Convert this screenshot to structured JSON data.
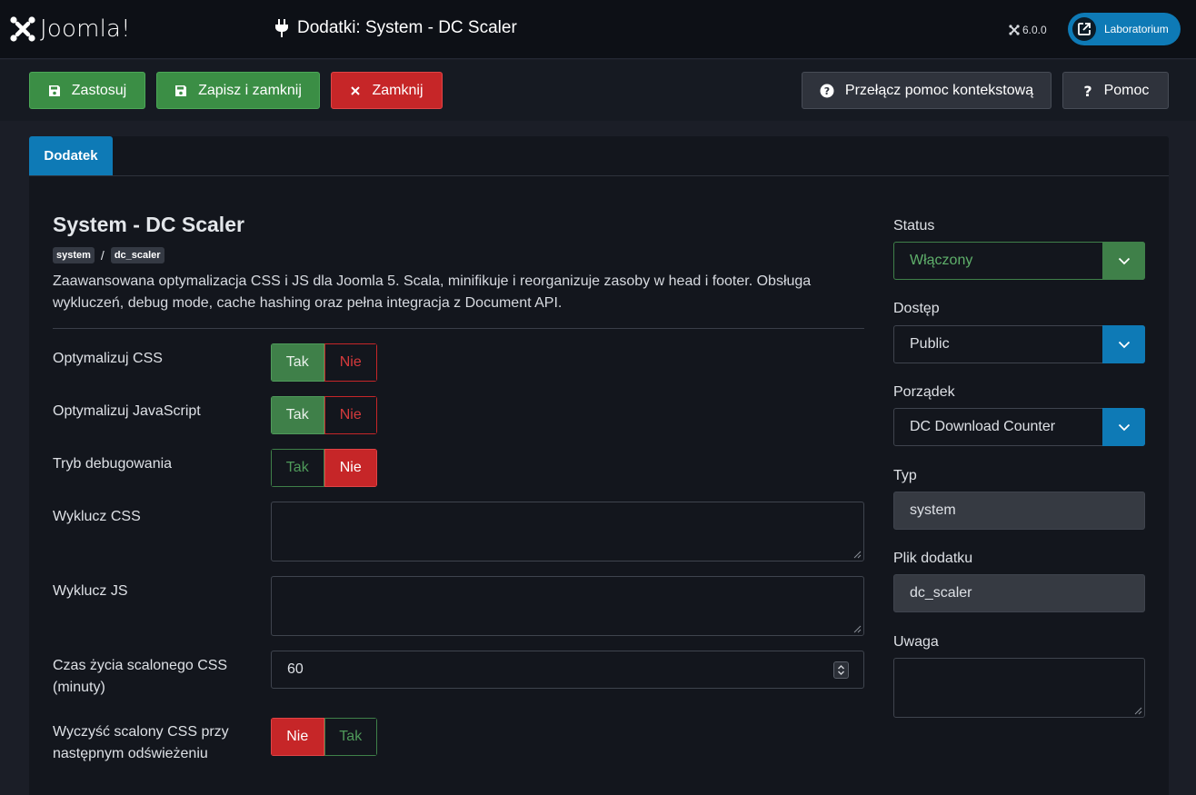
{
  "header": {
    "brand": "Joomla!",
    "page_title": "Dodatki: System - DC Scaler",
    "version": "6.0.0",
    "site_button": "Laboratorium"
  },
  "toolbar": {
    "apply": "Zastosuj",
    "save_close": "Zapisz i zamknij",
    "close": "Zamknij",
    "toggle_help": "Przełącz pomoc kontekstową",
    "help": "Pomoc"
  },
  "tabs": [
    {
      "label": "Dodatek"
    }
  ],
  "plugin": {
    "title": "System - DC Scaler",
    "group_badge": "system",
    "element_badge": "dc_scaler",
    "description": "Zaawansowana optymalizacja CSS i JS dla Joomla 5. Scala, minifikuje i reorganizuje zasoby w head i footer. Obsługa wykluczeń, debug mode, cache hashing oraz pełna integracja z Document API."
  },
  "fields": {
    "optimize_css": {
      "label": "Optymalizuj CSS",
      "yes": "Tak",
      "no": "Nie",
      "value": "Tak"
    },
    "optimize_js": {
      "label": "Optymalizuj JavaScript",
      "yes": "Tak",
      "no": "Nie",
      "value": "Tak"
    },
    "debug_mode": {
      "label": "Tryb debugowania",
      "yes": "Tak",
      "no": "Nie",
      "value": "Nie"
    },
    "exclude_css": {
      "label": "Wyklucz CSS",
      "value": ""
    },
    "exclude_js": {
      "label": "Wyklucz JS",
      "value": ""
    },
    "cache_lifetime": {
      "label": "Czas życia scalonego CSS (minuty)",
      "value": "60"
    },
    "clear_cache": {
      "label": "Wyczyść scalony CSS przy następnym odświeżeniu",
      "no": "Nie",
      "yes": "Tak",
      "value": "Nie"
    }
  },
  "sidebar": {
    "status": {
      "label": "Status",
      "value": "Włączony"
    },
    "access": {
      "label": "Dostęp",
      "value": "Public"
    },
    "ordering": {
      "label": "Porządek",
      "value": "DC Download Counter"
    },
    "type": {
      "label": "Typ",
      "value": "system"
    },
    "plugin_file": {
      "label": "Plik dodatku",
      "value": "dc_scaler"
    },
    "note": {
      "label": "Uwaga",
      "value": ""
    }
  },
  "colors": {
    "accent": "#0e7ab6",
    "success": "#3b8e45",
    "danger": "#c62628"
  }
}
